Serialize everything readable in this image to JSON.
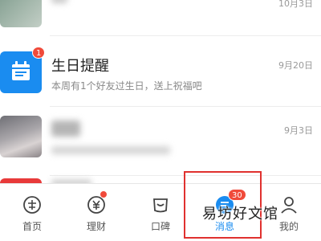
{
  "messages": [
    {
      "title": "",
      "subtitle": "",
      "date": "10月3日"
    },
    {
      "title": "生日提醒",
      "subtitle": "本周有1个好友过生日，送上祝福吧",
      "date": "9月20日",
      "badge": "1"
    },
    {
      "title": "",
      "subtitle": "",
      "date": "9月3日"
    },
    {
      "title": "",
      "subtitle": "",
      "date": ""
    }
  ],
  "tabs": [
    {
      "label": "首页",
      "icon": "home-icon"
    },
    {
      "label": "理财",
      "icon": "finance-icon"
    },
    {
      "label": "口碑",
      "icon": "koubei-icon"
    },
    {
      "label": "消息",
      "icon": "message-icon",
      "badge": "30"
    },
    {
      "label": "我的",
      "icon": "profile-icon"
    }
  ],
  "watermark": "易坊好文馆",
  "colors": {
    "accent": "#1a8cf0",
    "badge": "#f04a3a",
    "highlight": "#e0312f"
  }
}
